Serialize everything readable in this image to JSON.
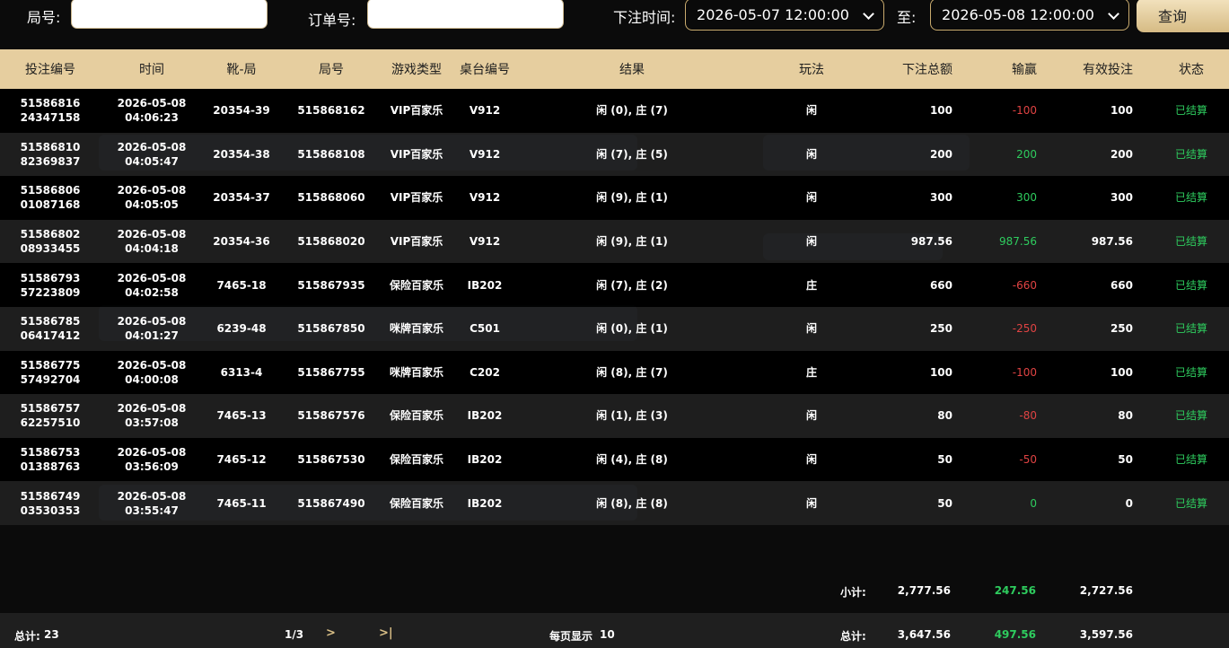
{
  "filters": {
    "round_label": "局号:",
    "round_value": "",
    "order_label": "订单号:",
    "order_value": "",
    "bet_time_label": "下注时间:",
    "start_time": "2026-05-07 12:00:00",
    "to_label": "至:",
    "end_time": "2026-05-08 12:00:00",
    "query_label": "查询"
  },
  "columns": [
    "投注编号",
    "时间",
    "靴-局",
    "局号",
    "游戏类型",
    "桌台编号",
    "结果",
    "玩法",
    "下注总额",
    "输赢",
    "有效投注",
    "状态"
  ],
  "rows": [
    {
      "id1": "51586816",
      "id2": "24347158",
      "date": "2026-05-08",
      "time": "04:06:23",
      "shoe": "20354-39",
      "round": "515868162",
      "game": "VIP百家乐",
      "table": "V912",
      "result": "闲 (0), 庄 (7)",
      "play": "闲",
      "bet": "100",
      "winloss": "-100",
      "valid": "100",
      "status": "已结算"
    },
    {
      "id1": "51586810",
      "id2": "82369837",
      "date": "2026-05-08",
      "time": "04:05:47",
      "shoe": "20354-38",
      "round": "515868108",
      "game": "VIP百家乐",
      "table": "V912",
      "result": "闲 (7), 庄 (5)",
      "play": "闲",
      "bet": "200",
      "winloss": "200",
      "valid": "200",
      "status": "已结算"
    },
    {
      "id1": "51586806",
      "id2": "01087168",
      "date": "2026-05-08",
      "time": "04:05:05",
      "shoe": "20354-37",
      "round": "515868060",
      "game": "VIP百家乐",
      "table": "V912",
      "result": "闲 (9), 庄 (1)",
      "play": "闲",
      "bet": "300",
      "winloss": "300",
      "valid": "300",
      "status": "已结算"
    },
    {
      "id1": "51586802",
      "id2": "08933455",
      "date": "2026-05-08",
      "time": "04:04:18",
      "shoe": "20354-36",
      "round": "515868020",
      "game": "VIP百家乐",
      "table": "V912",
      "result": "闲 (9), 庄 (1)",
      "play": "闲",
      "bet": "987.56",
      "winloss": "987.56",
      "valid": "987.56",
      "status": "已结算"
    },
    {
      "id1": "51586793",
      "id2": "57223809",
      "date": "2026-05-08",
      "time": "04:02:58",
      "shoe": "7465-18",
      "round": "515867935",
      "game": "保险百家乐",
      "table": "IB202",
      "result": "闲 (7), 庄 (2)",
      "play": "庄",
      "bet": "660",
      "winloss": "-660",
      "valid": "660",
      "status": "已结算"
    },
    {
      "id1": "51586785",
      "id2": "06417412",
      "date": "2026-05-08",
      "time": "04:01:27",
      "shoe": "6239-48",
      "round": "515867850",
      "game": "咪牌百家乐",
      "table": "C501",
      "result": "闲 (0), 庄 (1)",
      "play": "闲",
      "bet": "250",
      "winloss": "-250",
      "valid": "250",
      "status": "已结算"
    },
    {
      "id1": "51586775",
      "id2": "57492704",
      "date": "2026-05-08",
      "time": "04:00:08",
      "shoe": "6313-4",
      "round": "515867755",
      "game": "咪牌百家乐",
      "table": "C202",
      "result": "闲 (8), 庄 (7)",
      "play": "庄",
      "bet": "100",
      "winloss": "-100",
      "valid": "100",
      "status": "已结算"
    },
    {
      "id1": "51586757",
      "id2": "62257510",
      "date": "2026-05-08",
      "time": "03:57:08",
      "shoe": "7465-13",
      "round": "515867576",
      "game": "保险百家乐",
      "table": "IB202",
      "result": "闲 (1), 庄 (3)",
      "play": "闲",
      "bet": "80",
      "winloss": "-80",
      "valid": "80",
      "status": "已结算"
    },
    {
      "id1": "51586753",
      "id2": "01388763",
      "date": "2026-05-08",
      "time": "03:56:09",
      "shoe": "7465-12",
      "round": "515867530",
      "game": "保险百家乐",
      "table": "IB202",
      "result": "闲 (4), 庄 (8)",
      "play": "闲",
      "bet": "50",
      "winloss": "-50",
      "valid": "50",
      "status": "已结算"
    },
    {
      "id1": "51586749",
      "id2": "03530353",
      "date": "2026-05-08",
      "time": "03:55:47",
      "shoe": "7465-11",
      "round": "515867490",
      "game": "保险百家乐",
      "table": "IB202",
      "result": "闲 (8), 庄 (8)",
      "play": "闲",
      "bet": "50",
      "winloss": "0",
      "valid": "0",
      "status": "已结算"
    }
  ],
  "subtotal": {
    "label": "小计:",
    "bet": "2,777.56",
    "winloss": "247.56",
    "valid": "2,727.56"
  },
  "footer": {
    "count_label": "总计:",
    "count": "23",
    "page": "1/3",
    "next": ">",
    "last": ">|",
    "per_page_label": "每页显示",
    "per_page": "10",
    "total_label": "总计:",
    "bet": "3,647.56",
    "winloss": "497.56",
    "valid": "3,597.56"
  },
  "colors": {
    "header_bg": "#e6ce9f",
    "win": "#2ecc5e",
    "loss": "#e04343",
    "accent": "#d6bb84"
  }
}
